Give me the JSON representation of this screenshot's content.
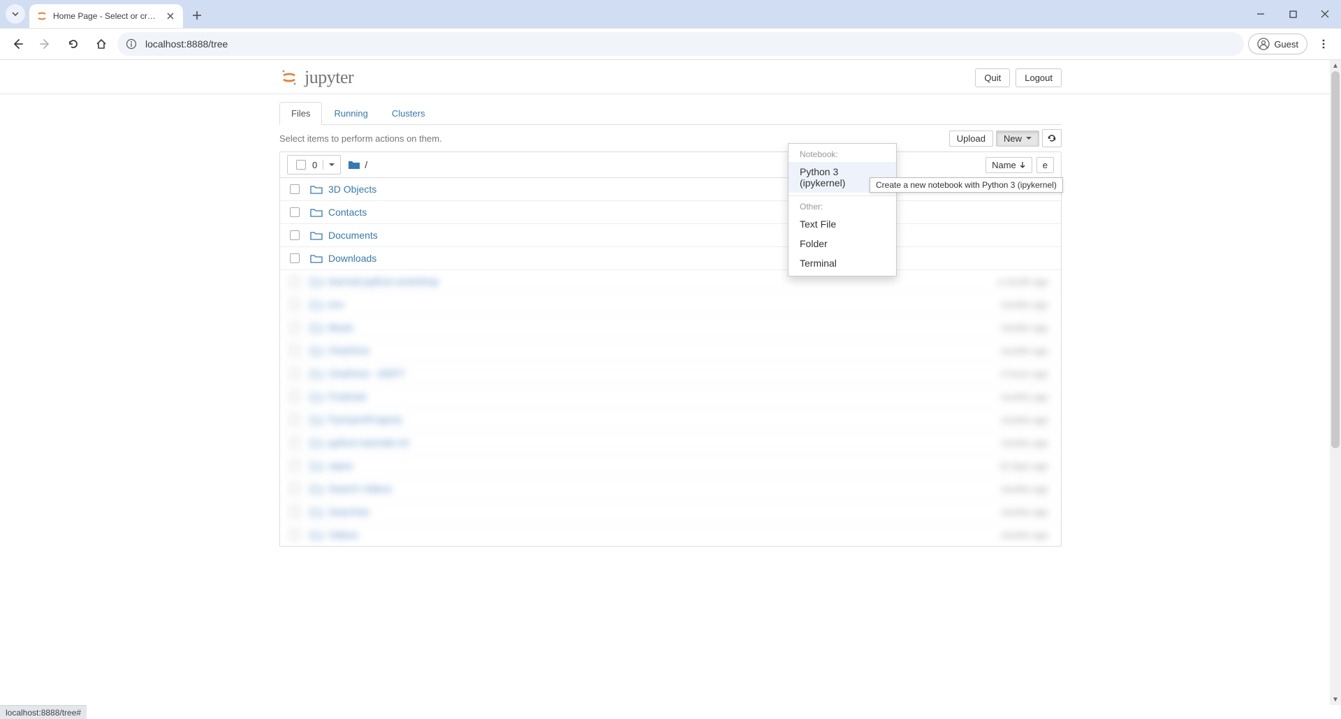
{
  "browser": {
    "tab_title": "Home Page - Select or create a",
    "url": "localhost:8888/tree",
    "profile_label": "Guest",
    "status_bar": "localhost:8888/tree#"
  },
  "header": {
    "logo_text": "jupyter",
    "quit": "Quit",
    "logout": "Logout"
  },
  "tabs": {
    "files": "Files",
    "running": "Running",
    "clusters": "Clusters"
  },
  "actions": {
    "help_text": "Select items to perform actions on them.",
    "upload": "Upload",
    "new": "New",
    "refresh_title": "Refresh"
  },
  "list_head": {
    "selected_count": "0",
    "breadcrumb_sep": "/",
    "sort_name": "Name",
    "size_label": "e"
  },
  "rows": [
    {
      "name": "3D Objects"
    },
    {
      "name": "Contacts"
    },
    {
      "name": "Documents"
    },
    {
      "name": "Downloads"
    }
  ],
  "blurred_rows": [
    {
      "name": "learned-python-workshop",
      "time": "a month ago"
    },
    {
      "name": "env",
      "time": "months ago"
    },
    {
      "name": "Music",
      "time": "months ago"
    },
    {
      "name": "OneDrive",
      "time": "months ago"
    },
    {
      "name": "OneDrive - MSFT",
      "time": "4 hours ago"
    },
    {
      "name": "Postman",
      "time": "months ago"
    },
    {
      "name": "PycharmProjects",
      "time": "months ago"
    },
    {
      "name": "python-tutorials-ml",
      "time": "months ago"
    },
    {
      "name": "repos",
      "time": "10 days ago"
    },
    {
      "name": "Search Videos",
      "time": "months ago"
    },
    {
      "name": "Searches",
      "time": "months ago"
    },
    {
      "name": "Videos",
      "time": "months ago"
    }
  ],
  "dropdown": {
    "header1": "Notebook:",
    "item_python": "Python 3 (ipykernel)",
    "header2": "Other:",
    "item_text": "Text File",
    "item_folder": "Folder",
    "item_terminal": "Terminal"
  },
  "tooltip": "Create a new notebook with Python 3 (ipykernel)"
}
